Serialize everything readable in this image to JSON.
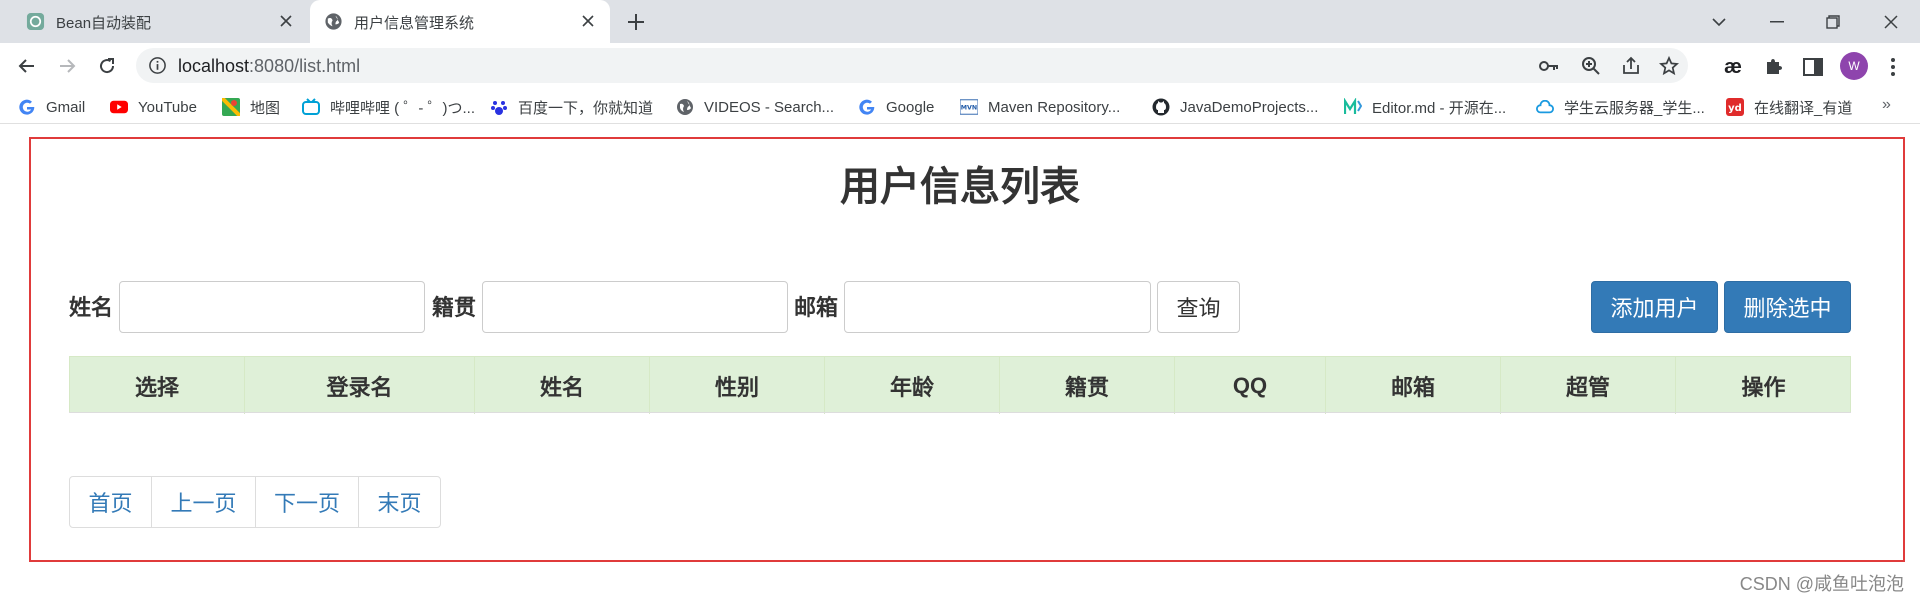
{
  "browser": {
    "tabs": [
      {
        "title": "Bean自动装配",
        "icon": "openai-icon",
        "active": false
      },
      {
        "title": "用户信息管理系统",
        "icon": "globe-icon",
        "active": true
      }
    ],
    "url_host": "localhost",
    "url_rest": ":8080/list.html",
    "avatar_letter": "W",
    "bookmarks": [
      {
        "label": "Gmail",
        "icon": "google-g-icon"
      },
      {
        "label": "YouTube",
        "icon": "youtube-icon"
      },
      {
        "label": "地图",
        "icon": "maps-icon"
      },
      {
        "label": "哔哩哔哩 ( ゜- ゜)つ...",
        "icon": "bilibili-icon"
      },
      {
        "label": "百度一下，你就知道",
        "icon": "baidu-icon"
      },
      {
        "label": "VIDEOS - Search...",
        "icon": "globe-icon"
      },
      {
        "label": "Google",
        "icon": "google-g-icon"
      },
      {
        "label": "Maven Repository...",
        "icon": "mvn-icon"
      },
      {
        "label": "JavaDemoProjects...",
        "icon": "github-icon"
      },
      {
        "label": "Editor.md - 开源在...",
        "icon": "editormd-icon"
      },
      {
        "label": "学生云服务器_学生...",
        "icon": "cloud-icon"
      },
      {
        "label": "在线翻译_有道",
        "icon": "youdao-icon"
      }
    ],
    "more_bookmarks": "»"
  },
  "page": {
    "title": "用户信息列表",
    "search": {
      "name_label": "姓名",
      "name_value": "",
      "hometown_label": "籍贯",
      "hometown_value": "",
      "email_label": "邮箱",
      "email_value": "",
      "query_button": "查询"
    },
    "actions": {
      "add_user": "添加用户",
      "delete_selected": "删除选中"
    },
    "table": {
      "columns": [
        "选择",
        "登录名",
        "姓名",
        "性别",
        "年龄",
        "籍贯",
        "QQ",
        "邮箱",
        "超管",
        "操作"
      ],
      "rows": []
    },
    "pagination": [
      "首页",
      "上一页",
      "下一页",
      "末页"
    ]
  },
  "watermark": "CSDN @咸鱼吐泡泡",
  "colors": {
    "frame_border": "#e03b3b",
    "primary": "#337ab7",
    "table_header_bg": "#dff0d8",
    "link": "#337ab7"
  }
}
